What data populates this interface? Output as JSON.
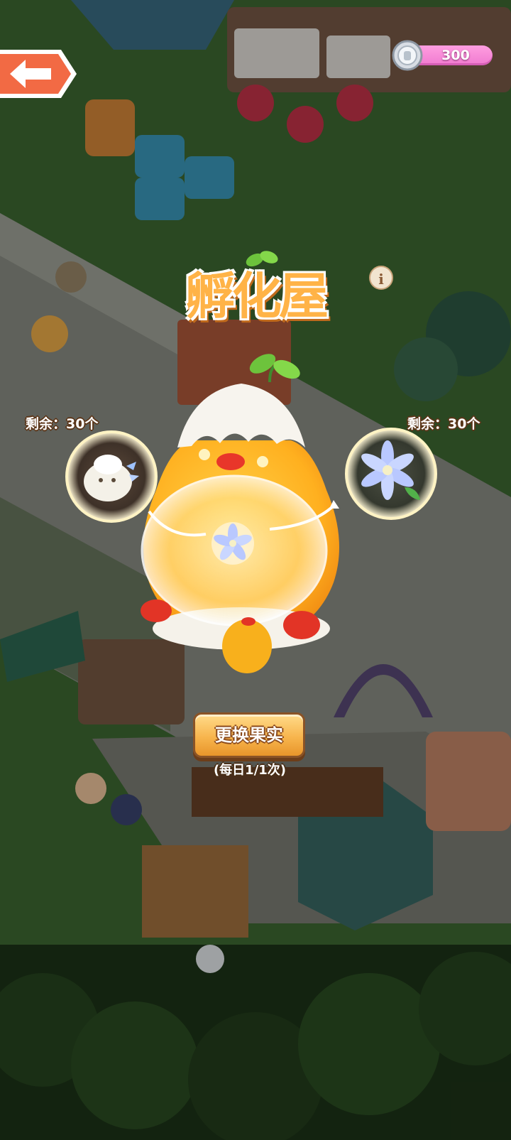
{
  "currency": {
    "value": "300",
    "icon": "silver-coin-icon"
  },
  "title": "孵化屋",
  "info_icon": "info-icon",
  "left_slot": {
    "remaining": "剩余：30个",
    "item": "white-fluff-creature-icon"
  },
  "right_slot": {
    "remaining": "剩余：30个",
    "item": "blue-lily-flower-icon"
  },
  "center_item": "blue-lily-flower-icon",
  "change_button": {
    "label": "更换果实"
  },
  "daily_limit": "(每日1/1次)",
  "colors": {
    "accent": "#f7b54d",
    "pill": "#f07ad0",
    "title": "#ffb347"
  }
}
